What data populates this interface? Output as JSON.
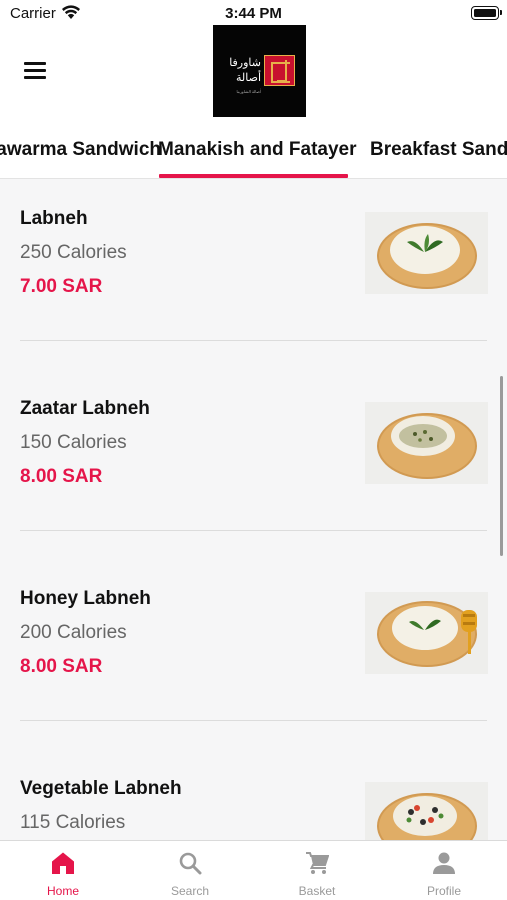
{
  "status_bar": {
    "carrier": "Carrier",
    "time": "3:44 PM"
  },
  "header": {
    "logo": {
      "text_line1": "شاورفا",
      "text_line2": "أصالة",
      "subtext": "أصالة الشاورما"
    }
  },
  "tabs": [
    {
      "label": "Shawarma Sandwich"
    },
    {
      "label": "Manakish and Fatayer",
      "active": true
    },
    {
      "label": "Breakfast Sandwiches"
    }
  ],
  "items": [
    {
      "name": "Labneh",
      "calories": "250 Calories",
      "price": "7.00 SAR",
      "image": "labneh-manakish-photo"
    },
    {
      "name": "Zaatar Labneh",
      "calories": "150 Calories",
      "price": "8.00 SAR",
      "image": "zaatar-labneh-manakish-photo"
    },
    {
      "name": "Honey Labneh",
      "calories": "200 Calories",
      "price": "8.00 SAR",
      "image": "honey-labneh-manakish-photo"
    },
    {
      "name": "Vegetable Labneh",
      "calories": "115 Calories",
      "price": "",
      "image": "vegetable-labneh-manakish-photo"
    }
  ],
  "bottom_nav": [
    {
      "label": "Home",
      "icon": "home-icon",
      "active": true
    },
    {
      "label": "Search",
      "icon": "search-icon"
    },
    {
      "label": "Basket",
      "icon": "cart-icon"
    },
    {
      "label": "Profile",
      "icon": "person-icon"
    }
  ],
  "colors": {
    "accent": "#e5154a",
    "inactive": "#9a9a9a",
    "logo_red": "#c8102e",
    "logo_gold": "#e7b04a"
  }
}
